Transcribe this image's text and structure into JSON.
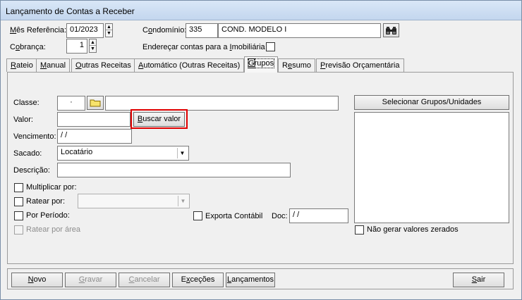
{
  "window": {
    "title": "Lançamento de Contas a Receber"
  },
  "header": {
    "mes_label_u": "M",
    "mes_label_rest": "ês Referência:",
    "mes_value": "01/2023",
    "cobranca_label_pre": "C",
    "cobranca_label_u": "o",
    "cobranca_label_rest": "brança:",
    "cobranca_value": "1",
    "condominio_label_pre": "C",
    "condominio_label_u": "o",
    "condominio_label_rest": "ndomínio:",
    "condominio_code": "335",
    "condominio_name": "COND. MODELO I",
    "enderecar_label_pre": "Endereçar contas para a ",
    "enderecar_label_u": "I",
    "enderecar_label_rest": "mobiliária"
  },
  "tabs": [
    {
      "pre": "",
      "u": "R",
      "rest": "ateio"
    },
    {
      "pre": "",
      "u": "M",
      "rest": "anual"
    },
    {
      "pre": "",
      "u": "O",
      "rest": "utras Receitas"
    },
    {
      "pre": "",
      "u": "A",
      "rest": "utomático (Outras Receitas)"
    },
    {
      "pre": "",
      "u": "G",
      "rest": "rupos"
    },
    {
      "pre": "R",
      "u": "e",
      "rest": "sumo"
    },
    {
      "pre": "",
      "u": "P",
      "rest": "revisão Orçamentária"
    }
  ],
  "form": {
    "classe_label": "Classe:",
    "classe_value": "·",
    "valor_label": "Valor:",
    "buscar_label_u": "B",
    "buscar_label_rest": "uscar valor",
    "vencimento_label": "Vencimento:",
    "vencimento_value": " / /",
    "sacado_label": "Sacado:",
    "sacado_value": "Locatário",
    "descricao_label": "Descrição:",
    "multiplicar_label": "Multiplicar por:",
    "ratear_label": "Ratear por:",
    "periodo_label": "Por Período:",
    "ratear_area_label": "Ratear por área",
    "exporta_label": "Exporta Contábil",
    "doc_label": "Doc:",
    "doc_value": " / /",
    "selecionar_label": "Selecionar Grupos/Unidades",
    "nao_gerar_label": "Não gerar valores zerados"
  },
  "footer": {
    "novo_u": "N",
    "novo_rest": "ovo",
    "gravar_u": "G",
    "gravar_rest": "ravar",
    "cancelar_u": "C",
    "cancelar_rest": "ancelar",
    "excecoes_pre": "E",
    "excecoes_u": "x",
    "excecoes_rest": "ceções",
    "lancamentos_u": "L",
    "lancamentos_rest": "ançamentos",
    "sair_u": "S",
    "sair_rest": "air"
  },
  "icons": {
    "binoculars": "binoculars-icon",
    "folder": "folder-icon"
  },
  "colors": {
    "highlight": "#e00000",
    "titlebar": "#c9dbf1",
    "folder": "#f7e36b"
  }
}
